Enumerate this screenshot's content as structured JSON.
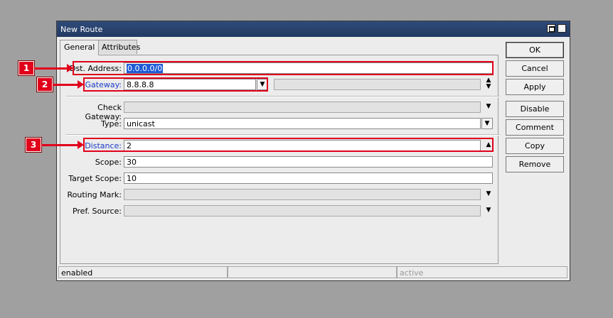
{
  "window": {
    "title": "New Route"
  },
  "tabs": [
    {
      "label": "General"
    },
    {
      "label": "Attributes"
    }
  ],
  "form": {
    "dst_address": {
      "label": "Dst. Address:",
      "value": "0.0.0.0/0"
    },
    "gateway": {
      "label": "Gateway:",
      "value": "8.8.8.8",
      "extra": ""
    },
    "check_gateway": {
      "label": "Check Gateway:",
      "value": ""
    },
    "type": {
      "label": "Type:",
      "value": "unicast"
    },
    "distance": {
      "label": "Distance:",
      "value": "2"
    },
    "scope": {
      "label": "Scope:",
      "value": "30"
    },
    "target_scope": {
      "label": "Target Scope:",
      "value": "10"
    },
    "routing_mark": {
      "label": "Routing Mark:",
      "value": ""
    },
    "pref_source": {
      "label": "Pref. Source:",
      "value": ""
    }
  },
  "buttons": {
    "ok": "OK",
    "cancel": "Cancel",
    "apply": "Apply",
    "disable": "Disable",
    "comment": "Comment",
    "copy": "Copy",
    "remove": "Remove"
  },
  "status": {
    "left": "enabled",
    "middle": "",
    "right": "active"
  },
  "annotations": {
    "one": "1",
    "two": "2",
    "three": "3"
  },
  "colors": {
    "highlight": "#e1001b",
    "title_bar": "#2a436f",
    "link_label": "#1a3cc8"
  },
  "icons": {
    "dropdown": "triangle-down",
    "updown": "spin-arrows",
    "close": "x",
    "maximize": "window"
  }
}
